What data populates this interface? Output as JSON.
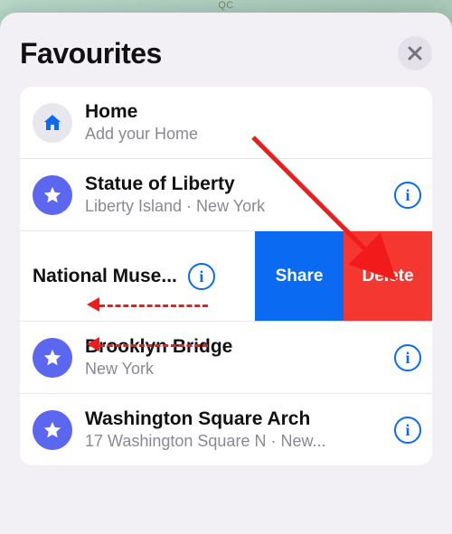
{
  "qc_label": "QC",
  "header": {
    "title": "Favourites",
    "close_icon": "close-icon"
  },
  "rows": [
    {
      "icon": "home",
      "title": "Home",
      "subtitle": "Add your Home",
      "info": false
    },
    {
      "icon": "star",
      "title": "Statue of Liberty",
      "subtitle": "Liberty Island · New York",
      "info": true
    },
    {
      "icon": "star",
      "title": "National Muse...",
      "subtitle": "",
      "info": true,
      "swiped": true
    },
    {
      "icon": "star",
      "title": "Brooklyn Bridge",
      "subtitle": "New York",
      "info": true
    },
    {
      "icon": "star",
      "title": "Washington Square Arch",
      "subtitle": "17 Washington Square N · New...",
      "info": true
    }
  ],
  "swipe": {
    "share_label": "Share",
    "delete_label": "Delete"
  },
  "colors": {
    "accent_blue": "#0a6bf2",
    "star_badge": "#5c67f0",
    "delete_red": "#f43831",
    "annotation_red": "#f21b1b"
  }
}
